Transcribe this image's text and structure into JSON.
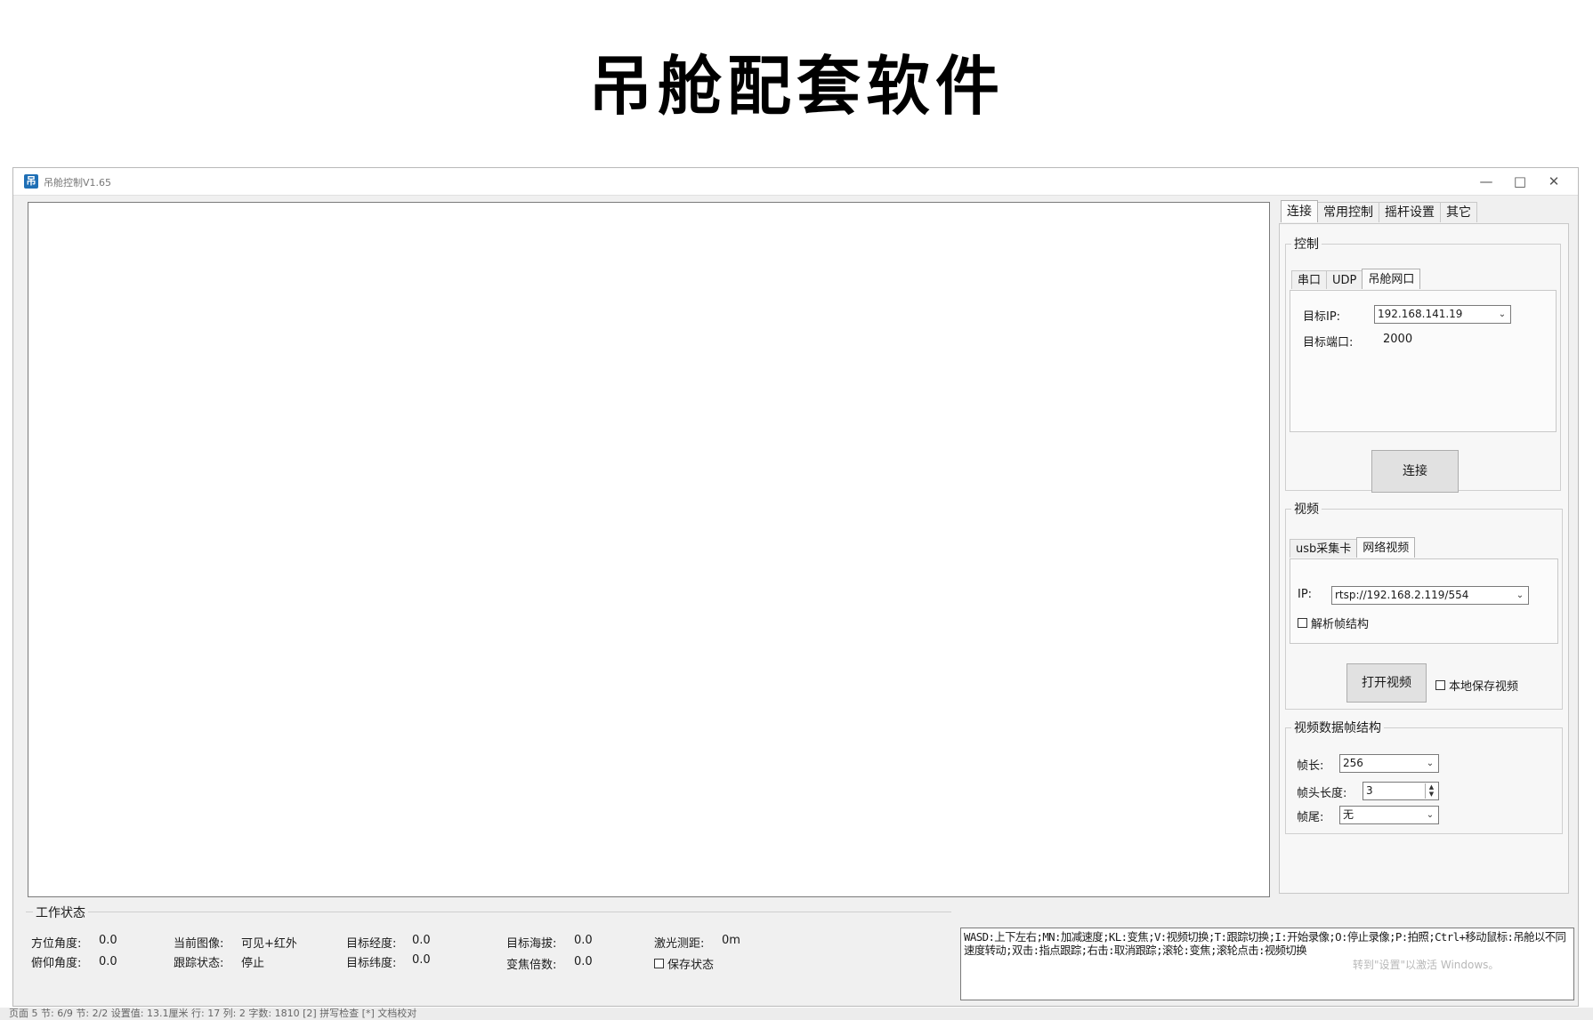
{
  "doc_title": "吊舱配套软件",
  "window": {
    "title": "吊舱控制V1.65",
    "minimize": "—",
    "maximize": "□",
    "close": "✕"
  },
  "tabs": [
    {
      "label": "连接",
      "active": true
    },
    {
      "label": "常用控制"
    },
    {
      "label": "摇杆设置"
    },
    {
      "label": "其它"
    }
  ],
  "control": {
    "legend": "控制",
    "subtabs": [
      "串口",
      "UDP",
      "吊舱网口"
    ],
    "target_ip_label": "目标IP:",
    "target_ip_value": "192.168.141.19",
    "target_port_label": "目标端口:",
    "target_port_value": "2000",
    "connect_label": "连接"
  },
  "video": {
    "legend": "视频",
    "subtabs": [
      "usb采集卡",
      "网络视频"
    ],
    "ip_label": "IP:",
    "ip_value": "rtsp://192.168.2.119/554",
    "parse_frame_label": "解析帧结构",
    "open_video_label": "打开视频",
    "local_save_label": "本地保存视频"
  },
  "frame_struct": {
    "legend": "视频数据帧结构",
    "frame_len_label": "帧长:",
    "frame_len_value": "256",
    "header_len_label": "帧头长度:",
    "header_len_value": "3",
    "tail_label": "帧尾:",
    "tail_value": "无"
  },
  "status": {
    "title": "工作状态",
    "azimuth_label": "方位角度:",
    "azimuth_value": "0.0",
    "pitch_label": "俯仰角度:",
    "pitch_value": "0.0",
    "current_image_label": "当前图像:",
    "current_image_value": "可见+红外",
    "track_state_label": "跟踪状态:",
    "track_state_value": "停止",
    "target_lon_label": "目标经度:",
    "target_lon_value": "0.0",
    "target_lat_label": "目标纬度:",
    "target_lat_value": "0.0",
    "target_alt_label": "目标海拔:",
    "target_alt_value": "0.0",
    "zoom_label": "变焦倍数:",
    "zoom_value": "0.0",
    "laser_label": "激光测距:",
    "laser_value": "0m",
    "save_state_label": "保存状态"
  },
  "help_text": "WASD:上下左右;MN:加减速度;KL:变焦;V:视频切换;T:跟踪切换;I:开始录像;O:停止录像;P:拍照;Ctrl+移动鼠标:吊舱以不同速度转动;双击:指点跟踪;右击:取消跟踪;滚轮:变焦;滚轮点击:视频切换",
  "watermark": "转到\"设置\"以激活 Windows。",
  "bottom_strip": "页面 5  节: 6/9  节: 2/2  设置值: 13.1厘米  行: 17  列: 2  字数: 1810  [2] 拼写检查  [*] 文档校对"
}
